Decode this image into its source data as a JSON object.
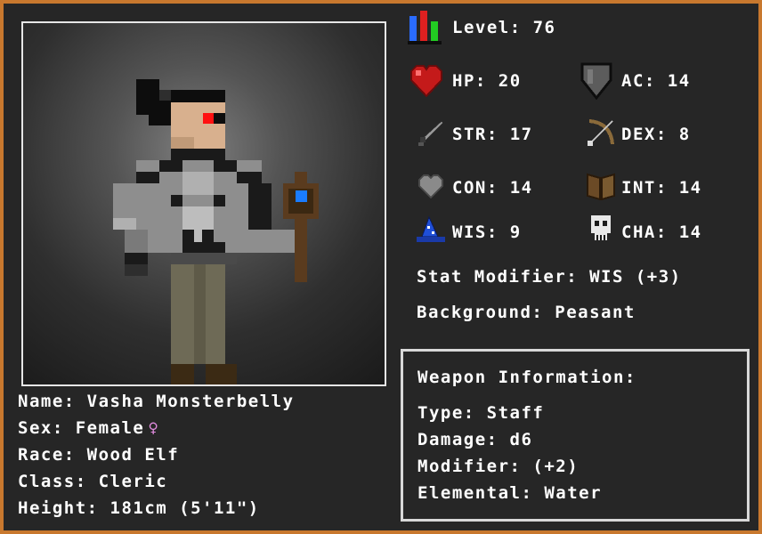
{
  "character": {
    "name_label": "Name: Vasha Monsterbelly",
    "sex_label": "Sex: Female",
    "sex_symbol": "♀",
    "race_label": "Race: Wood Elf",
    "class_label": "Class: Cleric",
    "height_label": "Height: 181cm (5'11\")"
  },
  "stats": {
    "level": "Level: 76",
    "hp": "HP: 20",
    "ac": "AC: 14",
    "str": "STR: 17",
    "dex": "DEX: 8",
    "con": "CON: 14",
    "int": "INT: 14",
    "wis": "WIS: 9",
    "cha": "CHA: 14",
    "stat_modifier": "Stat Modifier: WIS (+3)",
    "background": "Background: Peasant"
  },
  "weapon": {
    "header": "Weapon Information:",
    "type": "Type: Staff",
    "damage": "Damage: d6",
    "modifier": "Modifier: (+2)",
    "elemental": "Elemental: Water"
  },
  "icons": {
    "level": "level-bars-icon",
    "hp": "heart-icon",
    "ac": "shield-icon",
    "str": "sword-icon",
    "dex": "bow-icon",
    "con": "grey-heart-icon",
    "int": "book-icon",
    "wis": "wizard-hat-icon",
    "cha": "skull-icon"
  },
  "colors": {
    "frame": "#c8782e",
    "panel": "#262626",
    "text": "#ffffff",
    "female_symbol": "#e28ce0"
  }
}
